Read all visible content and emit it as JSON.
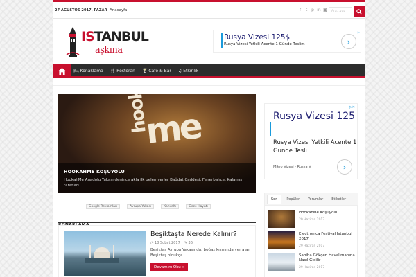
{
  "topbar": {
    "date": "27 AĞUSTOS 2017, PAZAR",
    "link": "Anasayfa",
    "search_placeholder": "Ara...yap"
  },
  "logo": {
    "main_a": "IS",
    "main_b": "TANBUL",
    "sub": "aşkına"
  },
  "header_ad": {
    "title": "Rusya Vizesi 125$",
    "desc": "Rusya Vizesi Yetkili Acente 1 Günde Teslim",
    "arrow": "›"
  },
  "nav": {
    "items": [
      {
        "icon": "🛏",
        "label": "Konaklama"
      },
      {
        "icon": "🍴",
        "label": "Restoran"
      },
      {
        "icon": "🍸",
        "label": "Cafe & Bar"
      },
      {
        "icon": "♫",
        "label": "Etkinlik"
      }
    ]
  },
  "slider": {
    "sign_a": "hookah",
    "sign_b": "me",
    "title": "HOOKAHME KOŞUYOLU",
    "desc": "HookahMe Anadolu Yakası denince akla ilk gelen yerler Bağdat Caddesi, Fenerbahçe, Kalamış tarafları..."
  },
  "maps_strip": [
    "Google Reklamları",
    "Avrupa Yakası",
    "Kahvaltı",
    "Gece Hayatı"
  ],
  "section": {
    "title": "KONAKLAMA"
  },
  "post": {
    "title": "Beşiktaşta Nerede Kalınır?",
    "date": "18 Şubat 2017",
    "comments": "36",
    "excerpt": "Beşiktaş  Avrupa Yakasında, boğaz kısmında yer alan Beşiktaş oldukça ...",
    "more": "Devamını Oku »"
  },
  "side_ad": {
    "title": "Rusya Vizesi 125",
    "desc": "Rusya Vizesi Yetkili Acente 1 Günde Tesli",
    "link": "Mikro Vizesi - Rusya V",
    "arrow": "›"
  },
  "tabs": [
    "Son",
    "Popüler",
    "Yorumlar",
    "Etiketler"
  ],
  "side_posts": [
    {
      "title": "HookahMe Koşuyolu",
      "date": "29 Haziran 2017"
    },
    {
      "title": "Electronica Festival Istanbul 2017",
      "date": "29 Haziran 2017"
    },
    {
      "title": "Sabiha Gökçen Havalimanına Nasıl Gidilir",
      "date": "29 Haziran 2017"
    }
  ],
  "colors": {
    "accent": "#c8102e",
    "nav_bg": "#2c2c2c",
    "ad_blue": "#1a1a6e"
  }
}
